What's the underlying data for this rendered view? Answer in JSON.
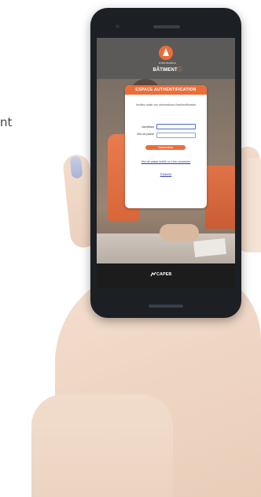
{
  "background": {
    "fragment_text": "nt"
  },
  "app": {
    "logo": {
      "line1": "Information",
      "line2_main": "BÂTIMENT",
      "line2_accent": "ⓘ"
    },
    "card": {
      "title": "ESPACE AUTHENTIFICATION",
      "instruction": "Veuillez saisir vos informations d'authentification",
      "identifier_label": "Identifiant",
      "identifier_value": "",
      "password_label": "Mot de passe",
      "password_value": "",
      "connect_label": "Connexion",
      "forgot_link": "Mot de passe oublié ou 1ère connexion",
      "register_link": "S'inscrire"
    },
    "footer": {
      "brand": "CAPEB"
    }
  },
  "colors": {
    "accent": "#ec6d3a",
    "link": "#2d3ea8",
    "footer_bg": "#1c1c1c"
  }
}
